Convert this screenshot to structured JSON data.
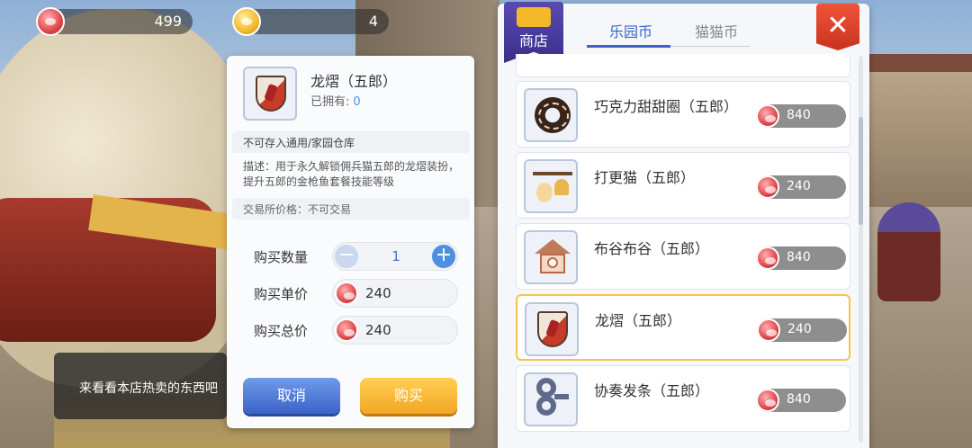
{
  "top_bar": {
    "park_coins": "499",
    "paw_coins": "4"
  },
  "detail": {
    "item_name": "龙熠（五郎）",
    "owned_label": "已拥有:",
    "owned_count": "0",
    "storage_note": "不可存入通用/家园仓库",
    "description": "描述：用于永久解锁佣兵猫五郎的龙熠装扮，提升五郎的金枪鱼套餐技能等级",
    "trade_price": "交易所价格：不可交易",
    "qty_label": "购买数量",
    "qty_value": "1",
    "unit_price_label": "购买单价",
    "unit_price": "240",
    "total_price_label": "购买总价",
    "total_price": "240",
    "cancel_label": "取消",
    "buy_label": "购买"
  },
  "hint": {
    "text": "来看看本店热卖的东西吧"
  },
  "shop": {
    "badge_label": "商店",
    "tabs": [
      {
        "label": "乐园币",
        "active": true
      },
      {
        "label": "猫猫币",
        "active": false
      }
    ],
    "items": [
      {
        "name": "巧克力甜甜圈（五郎）",
        "price": "840",
        "icon": "donut-icon"
      },
      {
        "name": "打更猫（五郎）",
        "price": "240",
        "icon": "bell-cat-icon"
      },
      {
        "name": "布谷布谷（五郎）",
        "price": "840",
        "icon": "cuckoo-clock-icon"
      },
      {
        "name": "龙熠（五郎）",
        "price": "240",
        "icon": "dragon-shield-icon",
        "selected": true
      },
      {
        "name": "协奏发条（五郎）",
        "price": "840",
        "icon": "wind-up-key-icon"
      }
    ]
  },
  "colors": {
    "accent_blue": "#3b63c9",
    "buy_orange": "#f3a623",
    "close_red": "#d8412a",
    "selected_border": "#f4c548"
  }
}
